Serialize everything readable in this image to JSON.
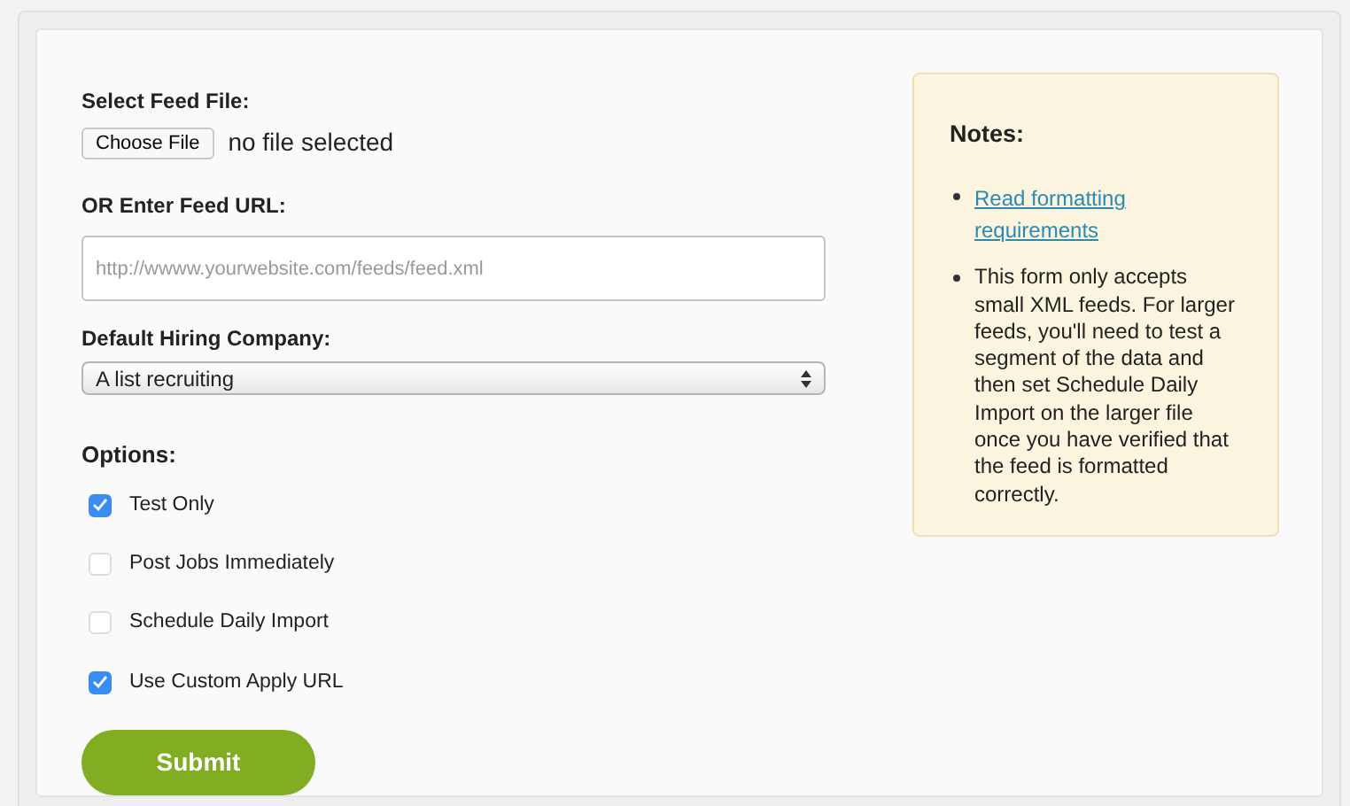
{
  "file_field": {
    "label": "Select Feed File:",
    "button": "Choose File",
    "status": "no file selected"
  },
  "url_field": {
    "label": "OR Enter Feed URL:",
    "placeholder": "http://wwww.yourwebsite.com/feeds/feed.xml"
  },
  "company_field": {
    "label": "Default Hiring Company:",
    "value": "A list recruiting"
  },
  "options": {
    "label": "Options:",
    "items": [
      {
        "label": "Test Only",
        "checked": true
      },
      {
        "label": "Post Jobs Immediately",
        "checked": false
      },
      {
        "label": "Schedule Daily Import",
        "checked": false
      },
      {
        "label": "Use Custom Apply URL",
        "checked": true
      }
    ]
  },
  "submit": "Submit",
  "notes": {
    "title": "Notes:",
    "items": [
      {
        "kind": "link",
        "text": "Read formatting requirements"
      },
      {
        "kind": "text",
        "text": "This form only accepts small XML feeds. For larger feeds, you'll need to test a segment of the data and then set Schedule Daily Import on the larger file once you have verified that the feed is formatted correctly."
      }
    ]
  }
}
